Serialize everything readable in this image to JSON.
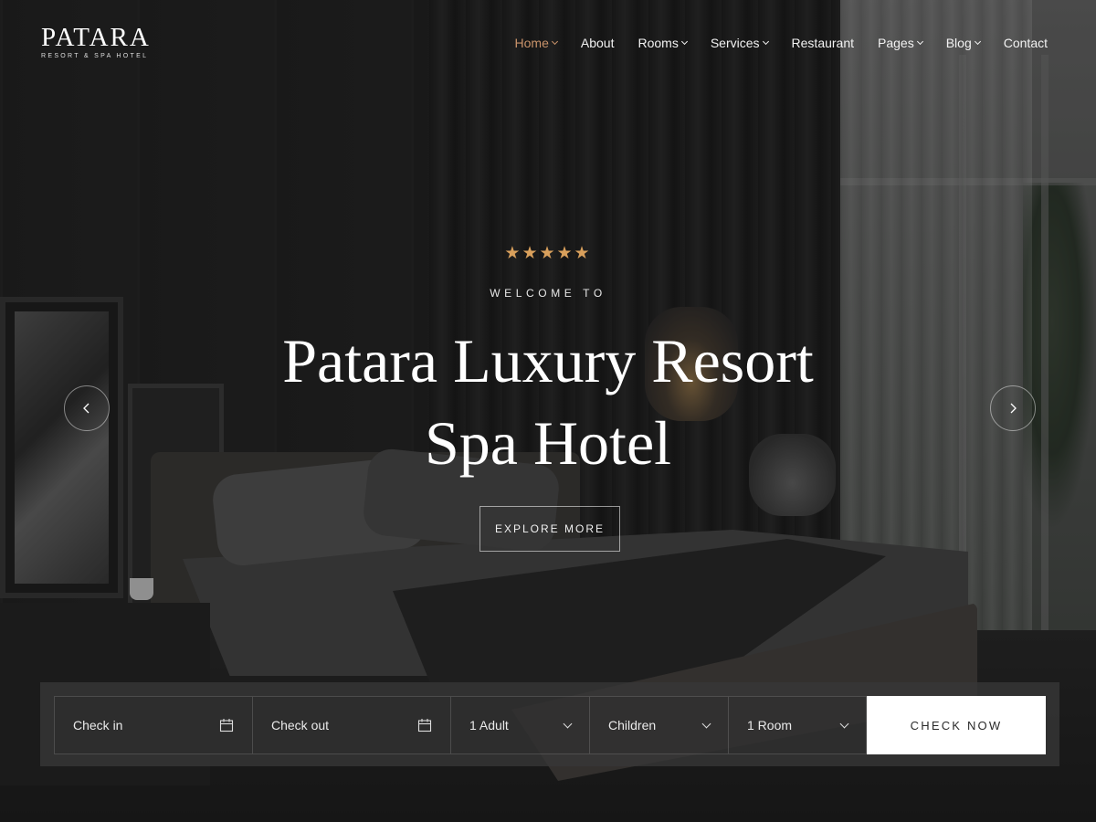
{
  "logo": {
    "name": "PATARA",
    "tagline": "RESORT & SPA HOTEL"
  },
  "nav": {
    "items": [
      {
        "label": "Home",
        "has_dropdown": true,
        "active": true
      },
      {
        "label": "About",
        "has_dropdown": false,
        "active": false
      },
      {
        "label": "Rooms",
        "has_dropdown": true,
        "active": false
      },
      {
        "label": "Services",
        "has_dropdown": true,
        "active": false
      },
      {
        "label": "Restaurant",
        "has_dropdown": false,
        "active": false
      },
      {
        "label": "Pages",
        "has_dropdown": true,
        "active": false
      },
      {
        "label": "Blog",
        "has_dropdown": true,
        "active": false
      },
      {
        "label": "Contact",
        "has_dropdown": false,
        "active": false
      }
    ]
  },
  "hero": {
    "stars": "★★★★★",
    "rating": 5,
    "welcome": "WELCOME TO",
    "title_line1": "Patara Luxury Resort",
    "title_line2": "Spa Hotel",
    "cta_label": "EXPLORE MORE",
    "prev_icon": "chevron-left-icon",
    "next_icon": "chevron-right-icon"
  },
  "booking": {
    "check_in": "Check in",
    "check_out": "Check out",
    "adults": "1 Adult",
    "children": "Children",
    "rooms": "1 Room",
    "submit_label": "CHECK NOW",
    "date_icon": "calendar-icon"
  },
  "colors": {
    "accent": "#c9936a",
    "stars": "#d9a05c",
    "button_bg": "#ffffff",
    "bar_bg": "#373737"
  }
}
